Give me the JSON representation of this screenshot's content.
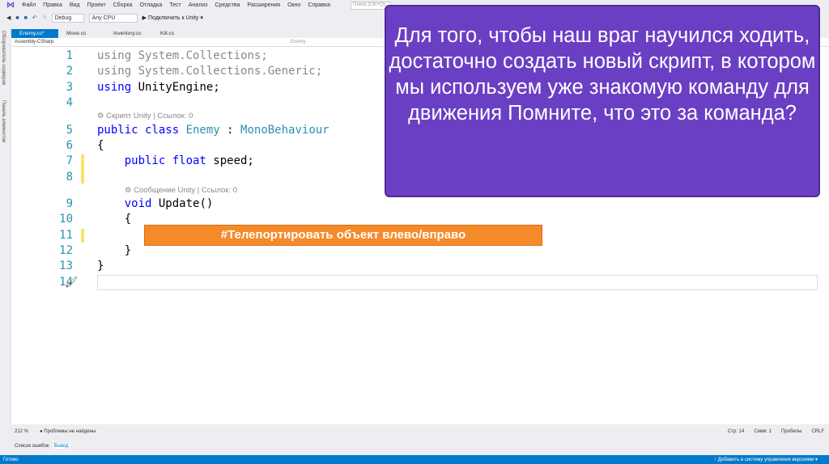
{
  "menu": [
    "Файл",
    "Правка",
    "Вид",
    "Проект",
    "Сборка",
    "Отладка",
    "Тест",
    "Анализ",
    "Средства",
    "Расширения",
    "Окно",
    "Справка"
  ],
  "search_placeholder": "Поиск (Ctrl+Q)",
  "toolbar": {
    "config": "Debug",
    "platform": "Any CPU",
    "attach": "▶ Подключить к Unity ▾"
  },
  "side": [
    "Обозреватель серверов",
    "Панель элементов"
  ],
  "tabs": [
    "Enemy.cs*",
    "Move.cs",
    "Inventory.cs",
    "Kill.cs"
  ],
  "nav": {
    "project": "Assembly-CSharp",
    "class": "Enemy"
  },
  "code": {
    "ln": [
      "1",
      "2",
      "3",
      "4",
      "5",
      "6",
      "7",
      "8",
      "9",
      "10",
      "11",
      "12",
      "13",
      "14"
    ],
    "l1a": "using",
    "l1b": " System.Collections;",
    "l2a": "using",
    "l2b": " System.Collections.Generic;",
    "l3a": "using",
    "l3b": " UnityEngine;",
    "lens1": "⚙ Скрипт Unity | Ссылок: 0",
    "l5a": "public class ",
    "l5b": "Enemy",
    " l5c": "",
    "l5d": " : ",
    "l5e": "MonoBehaviour",
    "l6": "{",
    "l7a": "    public float",
    "l7b": " speed;",
    "lens2": "⚙ Сообщение Unity | Ссылок: 0",
    "l9a": "    void",
    "l9b": " Update()",
    "l10": "    {",
    "l12": "    }",
    "l13": "}"
  },
  "overlay": {
    "purple": "Для того, чтобы наш враг научился ходить, достаточно создать новый скрипт, в котором мы используем уже знакомую команду для движения Помните, что это за команда?",
    "orange": "#Телепортировать объект влево/вправо"
  },
  "zoombar": {
    "zoom": "212 %",
    "problems": "● Проблемы не найдены",
    "line": "Стр: 14",
    "col": "Симв: 1",
    "spaces": "Пробелы",
    "eol": "CRLF"
  },
  "errtabs": [
    "Список ошибок",
    "Вывод"
  ],
  "status": {
    "ready": "Готово",
    "vcs": "↑ Добавить в систему управления версиями ▾"
  }
}
